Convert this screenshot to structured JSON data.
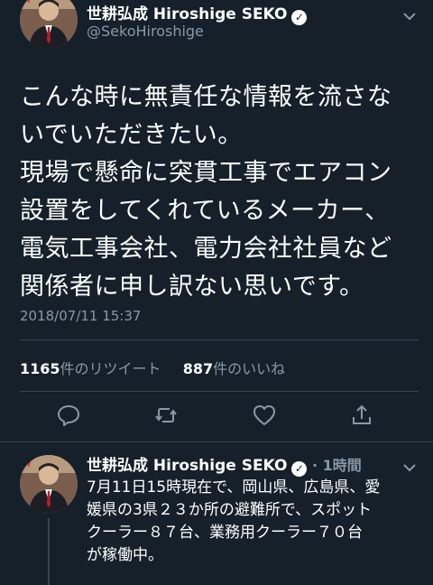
{
  "tweet": {
    "display_name": "世耕弘成 Hiroshige SEKO",
    "handle": "@SekoHiroshige",
    "text_lines": [
      "こんな時に無責任な情報を流さな",
      "いでいただきたい。",
      "現場で懸命に突貫工事でエアコン",
      "設置をしてくれているメーカー、",
      "電気工事会社、電力会社社員など",
      "関係者に申し訳ない思いです。"
    ],
    "timestamp": "2018/07/11 15:37",
    "retweet_count": "1165",
    "retweet_label": "件のリツイート",
    "like_count": "887",
    "like_label": "件のいいね"
  },
  "icons": {
    "verified": "verified-badge-icon",
    "chevron": "chevron-down-icon",
    "reply": "reply-icon",
    "retweet": "retweet-icon",
    "like": "heart-icon",
    "share": "share-icon"
  },
  "reply_tweet": {
    "display_name": "世耕弘成 Hiroshige SEKO",
    "relative_time": "1時間",
    "text_lines": [
      "7月11日15時現在で、岡山県、広島県、愛",
      "媛県の3県２３か所の避難所で、スポット",
      "クーラー８７台、業務用クーラー７０台",
      "が稼働中。"
    ]
  },
  "colors": {
    "background": "#15202b",
    "secondary_text": "#8899a6",
    "divider": "#38444d"
  }
}
